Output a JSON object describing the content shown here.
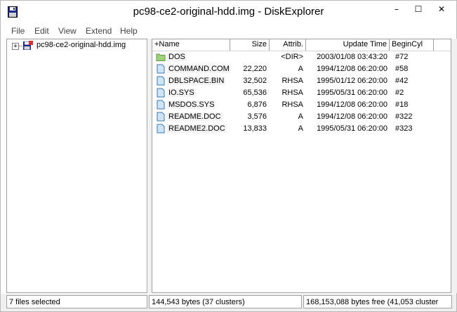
{
  "window": {
    "title": "pc98-ce2-original-hdd.img - DiskExplorer",
    "app_icon": "floppy-disk-icon",
    "controls": {
      "minimize": "–",
      "maximize": "☐",
      "close": "✕"
    }
  },
  "menu": [
    "File",
    "Edit",
    "View",
    "Extend",
    "Help"
  ],
  "tree": {
    "expander": "+",
    "root_label": "pc98-ce2-original-hdd.img",
    "root_icon": "disk-drive-icon"
  },
  "list": {
    "columns": {
      "name": "+Name",
      "size": "Size",
      "attrib": "Attrib.",
      "update_time": "Update Time",
      "begin_cyl": "BeginCyl"
    },
    "rows": [
      {
        "icon": "folder-icon",
        "name": "DOS",
        "size": "",
        "attrib": "<DIR>",
        "update_time": "2003/01/08 03:43:20",
        "begin_cyl": "#72"
      },
      {
        "icon": "file-icon",
        "name": "COMMAND.COM",
        "size": "22,220",
        "attrib": "A",
        "update_time": "1994/12/08 06:20:00",
        "begin_cyl": "#58"
      },
      {
        "icon": "file-icon",
        "name": "DBLSPACE.BIN",
        "size": "32,502",
        "attrib": "RHSA",
        "update_time": "1995/01/12 06:20:00",
        "begin_cyl": "#42"
      },
      {
        "icon": "file-icon",
        "name": "IO.SYS",
        "size": "65,536",
        "attrib": "RHSA",
        "update_time": "1995/05/31 06:20:00",
        "begin_cyl": "#2"
      },
      {
        "icon": "file-icon",
        "name": "MSDOS.SYS",
        "size": "6,876",
        "attrib": "RHSA",
        "update_time": "1994/12/08 06:20:00",
        "begin_cyl": "#18"
      },
      {
        "icon": "file-icon",
        "name": "README.DOC",
        "size": "3,576",
        "attrib": "A",
        "update_time": "1994/12/08 06:20:00",
        "begin_cyl": "#322"
      },
      {
        "icon": "file-icon",
        "name": "README2.DOC",
        "size": "13,833",
        "attrib": "A",
        "update_time": "1995/05/31 06:20:00",
        "begin_cyl": "#323"
      }
    ]
  },
  "status": {
    "selected": "7 files selected",
    "used": "144,543 bytes (37 clusters)",
    "free": "168,153,088 bytes free (41,053 cluster"
  },
  "colors": {
    "folder": "#9fd07a",
    "file_border": "#3a7ab8",
    "file_fill": "#cfe5f7"
  }
}
